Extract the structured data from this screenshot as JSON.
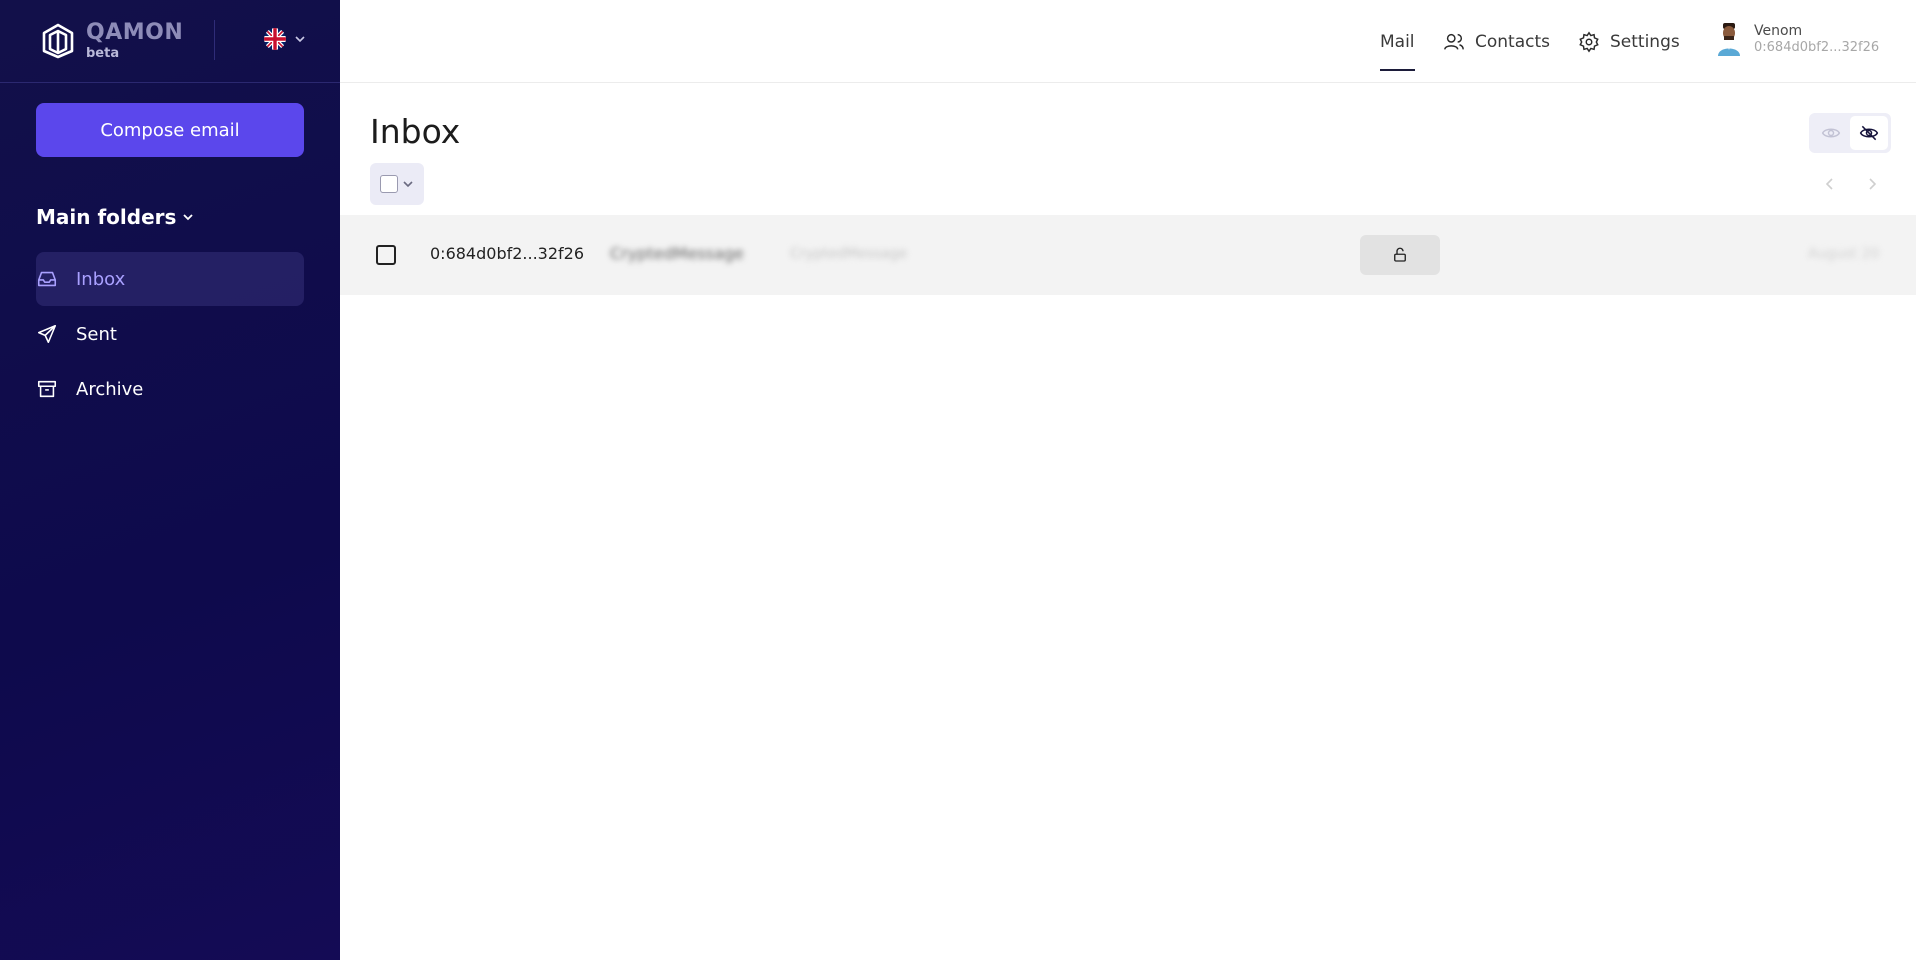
{
  "brand": {
    "name": "QAMON",
    "tag": "beta"
  },
  "sidebar": {
    "compose_label": "Compose email",
    "folders_title": "Main folders",
    "items": [
      {
        "label": "Inbox",
        "icon": "inbox-icon",
        "active": true
      },
      {
        "label": "Sent",
        "icon": "send-icon",
        "active": false
      },
      {
        "label": "Archive",
        "icon": "archive-icon",
        "active": false
      }
    ]
  },
  "header": {
    "tabs": [
      {
        "label": "Mail",
        "active": true
      },
      {
        "label": "Contacts",
        "icon": "contacts-icon"
      },
      {
        "label": "Settings",
        "icon": "gear-icon"
      }
    ],
    "user": {
      "name": "Venom",
      "address": "0:684d0bf2...32f26"
    }
  },
  "main": {
    "title": "Inbox",
    "messages": [
      {
        "sender": "0:684d0bf2...32f26",
        "subject": "CryptedMessage",
        "preview": "CryptedMessage",
        "date": "August 20"
      }
    ]
  },
  "colors": {
    "sidebar_bg": "#0e0a4c",
    "accent": "#5b47ec",
    "active_text": "#a9a0ff"
  }
}
